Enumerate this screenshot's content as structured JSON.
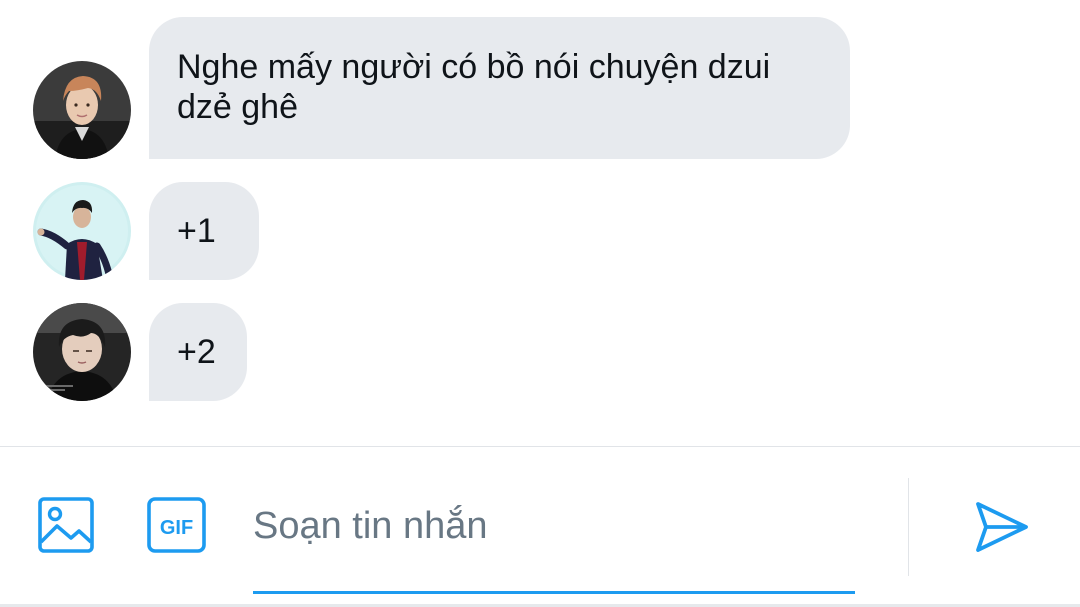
{
  "messages": [
    {
      "text": "Nghe mấy người có bồ nói chuyện dzui dzẻ ghê",
      "avatar": "avatar-user-1"
    },
    {
      "text": "+1",
      "avatar": "avatar-user-2"
    },
    {
      "text": "+2",
      "avatar": "avatar-user-3"
    }
  ],
  "composer": {
    "placeholder": "Soạn tin nhắn",
    "gif_label": "GIF",
    "media_icon": "image-icon",
    "send_icon": "send-icon"
  },
  "colors": {
    "accent": "#1d9bf0",
    "bubble": "#e7eaee",
    "text": "#0f1419",
    "placeholder": "#687784",
    "divider": "#e1e4e8"
  }
}
